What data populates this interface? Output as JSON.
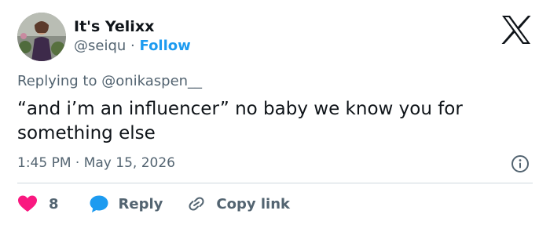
{
  "author": {
    "display_name": "It's Yelixx",
    "handle": "@seiqu",
    "separator": "·",
    "follow_label": "Follow"
  },
  "reply_context": "Replying to @onikaspen__",
  "tweet": {
    "text": "“and i’m an influencer” no baby we know you for something else",
    "timestamp": "1:45 PM · May 15, 2026"
  },
  "actions": {
    "like_count": "8",
    "reply_label": "Reply",
    "copy_link_label": "Copy link"
  },
  "icons": {
    "logo": "x-logo-icon",
    "info": "info-icon",
    "like": "heart-icon",
    "reply": "speech-bubble-icon",
    "copy": "link-icon"
  },
  "colors": {
    "text": "#0f1419",
    "secondary": "#536471",
    "accent": "#1d9bf0",
    "like": "#f91880",
    "divider": "#cfd9de"
  }
}
